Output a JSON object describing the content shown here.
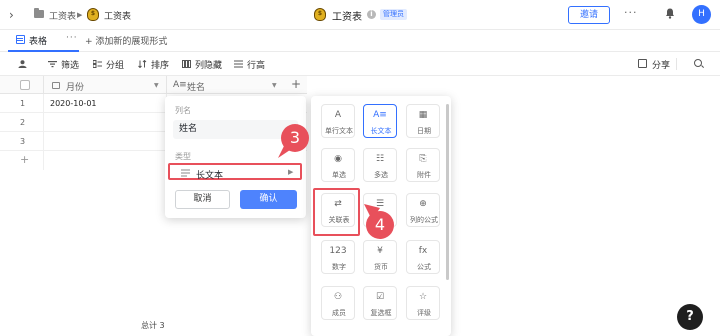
{
  "topbar": {
    "breadcrumb_parent": "工资表",
    "breadcrumb_current": "工资表",
    "title": "工资表",
    "role_badge": "管理员",
    "invite_label": "邀请",
    "more_label": "···",
    "avatar_initial": "H"
  },
  "tabs": {
    "active_label": "表格",
    "tab_more": "···",
    "add_view_label": "+ 添加新的展现形式"
  },
  "toolbar": {
    "filter": "筛选",
    "group": "分组",
    "sort": "排序",
    "hide_columns": "列隐藏",
    "row_height": "行高",
    "share": "分享"
  },
  "grid": {
    "columns": [
      "月份",
      "姓名"
    ],
    "add_column": "+",
    "rows": [
      {
        "num": "1",
        "month": "2020-10-01"
      },
      {
        "num": "2",
        "month": ""
      },
      {
        "num": "3",
        "month": ""
      }
    ],
    "add_row": "+",
    "footer_total": "总计 3"
  },
  "field_popup": {
    "name_label": "列名",
    "name_value": "姓名",
    "type_label": "类型",
    "type_value": "长文本",
    "cancel": "取消",
    "confirm": "确认"
  },
  "type_picker": {
    "types": [
      {
        "icon": "A",
        "label": "单行文本"
      },
      {
        "icon": "A≡",
        "label": "长文本"
      },
      {
        "icon": "▦",
        "label": "日期"
      },
      {
        "icon": "◉",
        "label": "单选"
      },
      {
        "icon": "☷",
        "label": "多选"
      },
      {
        "icon": "⎘",
        "label": "附件"
      },
      {
        "icon": "⇄",
        "label": "关联表"
      },
      {
        "icon": "☰",
        "label": ""
      },
      {
        "icon": "⊕",
        "label": "列的公式"
      },
      {
        "icon": "123",
        "label": "数字"
      },
      {
        "icon": "¥",
        "label": "货币"
      },
      {
        "icon": "fx",
        "label": "公式"
      },
      {
        "icon": "⚇",
        "label": "成员"
      },
      {
        "icon": "☑",
        "label": "复选框"
      },
      {
        "icon": "☆",
        "label": "评级"
      }
    ]
  },
  "steps": [
    "3",
    "4"
  ],
  "help_label": "?",
  "colors": {
    "accent": "#3370ff",
    "confirm_button": "#4e83fd",
    "highlight": "#e8505b",
    "help_button": "#1f1f1f"
  }
}
